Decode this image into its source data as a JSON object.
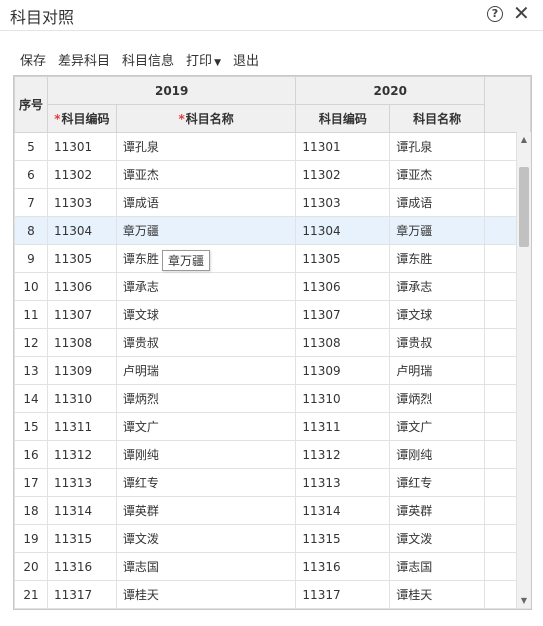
{
  "window": {
    "title": "科目对照"
  },
  "toolbar": {
    "save": "保存",
    "diff": "差异科目",
    "info": "科目信息",
    "print": "打印",
    "exit": "退出"
  },
  "grid": {
    "seq_header": "序号",
    "group_2019": "2019",
    "group_2020": "2020",
    "code_header": "科目编码",
    "name_header": "科目名称",
    "required_mark": "*",
    "rows": [
      {
        "seq": "5",
        "code19": "11301",
        "name19": "谭孔泉",
        "code20": "11301",
        "name20": "谭孔泉"
      },
      {
        "seq": "6",
        "code19": "11302",
        "name19": "谭亚杰",
        "code20": "11302",
        "name20": "谭亚杰"
      },
      {
        "seq": "7",
        "code19": "11303",
        "name19": "谭成语",
        "code20": "11303",
        "name20": "谭成语"
      },
      {
        "seq": "8",
        "code19": "11304",
        "name19": "章万疆",
        "code20": "11304",
        "name20": "章万疆"
      },
      {
        "seq": "9",
        "code19": "11305",
        "name19": "谭东胜",
        "code20": "11305",
        "name20": "谭东胜"
      },
      {
        "seq": "10",
        "code19": "11306",
        "name19": "谭承志",
        "code20": "11306",
        "name20": "谭承志"
      },
      {
        "seq": "11",
        "code19": "11307",
        "name19": "谭文球",
        "code20": "11307",
        "name20": "谭文球"
      },
      {
        "seq": "12",
        "code19": "11308",
        "name19": "谭贵叔",
        "code20": "11308",
        "name20": "谭贵叔"
      },
      {
        "seq": "13",
        "code19": "11309",
        "name19": "卢明瑞",
        "code20": "11309",
        "name20": "卢明瑞"
      },
      {
        "seq": "14",
        "code19": "11310",
        "name19": "谭炳烈",
        "code20": "11310",
        "name20": "谭炳烈"
      },
      {
        "seq": "15",
        "code19": "11311",
        "name19": "谭文广",
        "code20": "11311",
        "name20": "谭文广"
      },
      {
        "seq": "16",
        "code19": "11312",
        "name19": "谭刚纯",
        "code20": "11312",
        "name20": "谭刚纯"
      },
      {
        "seq": "17",
        "code19": "11313",
        "name19": "谭红专",
        "code20": "11313",
        "name20": "谭红专"
      },
      {
        "seq": "18",
        "code19": "11314",
        "name19": "谭英群",
        "code20": "11314",
        "name20": "谭英群"
      },
      {
        "seq": "19",
        "code19": "11315",
        "name19": "谭文泼",
        "code20": "11315",
        "name20": "谭文泼"
      },
      {
        "seq": "20",
        "code19": "11316",
        "name19": "谭志国",
        "code20": "11316",
        "name20": "谭志国"
      },
      {
        "seq": "21",
        "code19": "11317",
        "name19": "谭桂天",
        "code20": "11317",
        "name20": "谭桂天"
      }
    ],
    "selected_seq": "8"
  },
  "tooltip": {
    "text": "章万疆"
  },
  "icons": {
    "help": "help-circle-icon",
    "close": "close-icon"
  },
  "colors": {
    "selected_row": "#e8f2fc",
    "required": "#e23c3c"
  }
}
